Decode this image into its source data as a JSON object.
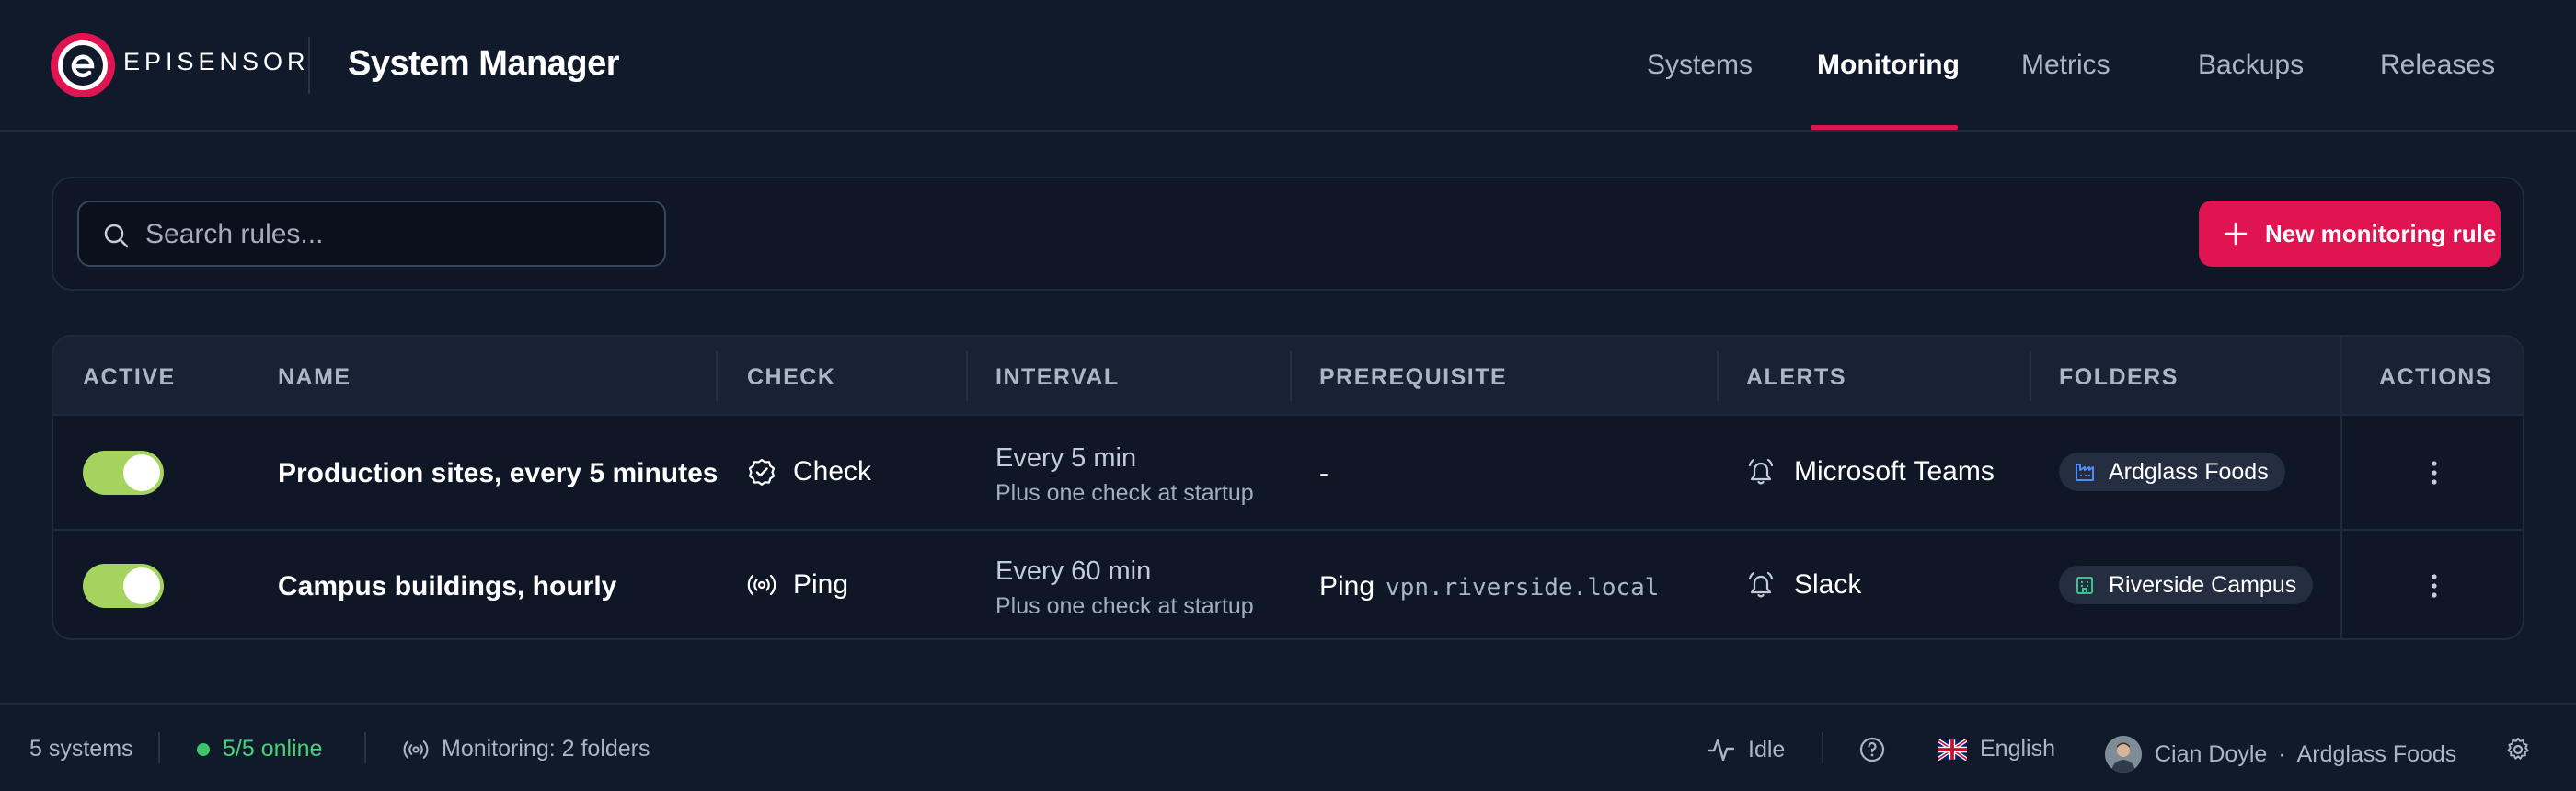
{
  "header": {
    "brand": "EPISENSOR",
    "title": "System Manager",
    "nav": [
      {
        "label": "Systems",
        "active": false
      },
      {
        "label": "Monitoring",
        "active": true
      },
      {
        "label": "Metrics",
        "active": false
      },
      {
        "label": "Backups",
        "active": false
      },
      {
        "label": "Releases",
        "active": false
      }
    ]
  },
  "toolbar": {
    "search_placeholder": "Search rules...",
    "new_button_label": "New monitoring rule"
  },
  "table": {
    "columns": [
      "ACTIVE",
      "NAME",
      "CHECK",
      "INTERVAL",
      "PREREQUISITE",
      "ALERTS",
      "FOLDERS",
      "ACTIONS"
    ],
    "rows": [
      {
        "active": true,
        "name": "Production sites, every 5 minutes",
        "check": "Check",
        "check_icon": "check-badge-icon",
        "interval": "Every 5 min",
        "interval_sub": "Plus one check at startup",
        "prerequisite": "-",
        "prerequisite_host": "",
        "alert": "Microsoft Teams",
        "folder": "Ardglass Foods",
        "folder_icon": "factory-icon",
        "folder_icon_color": "#4f8cf7"
      },
      {
        "active": true,
        "name": "Campus buildings, hourly",
        "check": "Ping",
        "check_icon": "broadcast-icon",
        "interval": "Every 60 min",
        "interval_sub": "Plus one check at startup",
        "prerequisite": "Ping",
        "prerequisite_host": "vpn.riverside.local",
        "alert": "Slack",
        "folder": "Riverside Campus",
        "folder_icon": "building-icon",
        "folder_icon_color": "#35c48a"
      }
    ]
  },
  "statusbar": {
    "systems": "5 systems",
    "online": "5/5 online",
    "monitoring": "Monitoring: 2 folders",
    "activity": "Idle",
    "language": "English",
    "user": "Cian Doyle",
    "separator": "·",
    "org": "Ardglass Foods"
  },
  "colors": {
    "accent": "#e01450",
    "toggle_on": "#a5d45e",
    "online": "#48d178",
    "background": "#111a2a"
  }
}
